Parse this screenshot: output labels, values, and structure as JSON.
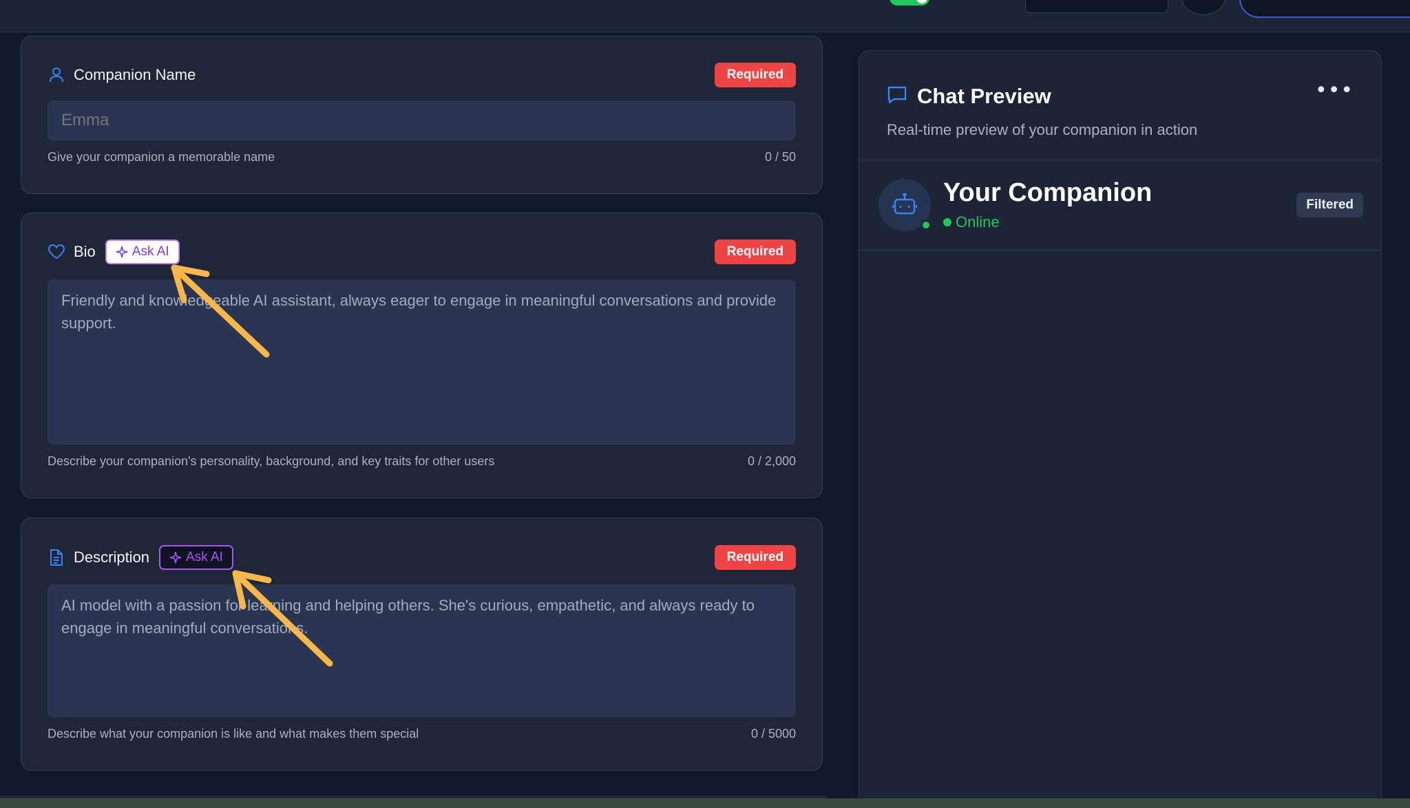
{
  "form": {
    "name": {
      "label": "Companion Name",
      "badge": "Required",
      "placeholder": "Emma",
      "hint": "Give your companion a memorable name",
      "count": "0 / 50"
    },
    "bio": {
      "label": "Bio",
      "ask_ai": "Ask AI",
      "badge": "Required",
      "placeholder": "Friendly and knowledgeable AI assistant, always eager to engage in meaningful conversations and provide support.",
      "hint": "Describe your companion's personality, background, and key traits for other users",
      "count": "0 / 2,000"
    },
    "description": {
      "label": "Description",
      "ask_ai": "Ask AI",
      "badge": "Required",
      "placeholder": "AI model with a passion for learning and helping others. She's curious, empathetic, and always ready to engage in meaningful conversations.",
      "hint": "Describe what your companion is like and what makes them special",
      "count": "0 / 5000"
    }
  },
  "preview": {
    "title": "Chat Preview",
    "subtitle": "Real-time preview of your companion in action",
    "companion_name": "Your Companion",
    "status": "Online",
    "badge": "Filtered"
  },
  "colors": {
    "accent_blue": "#3b82f6",
    "required_red": "#ef4444",
    "ask_ai_purple": "#a855f7",
    "online_green": "#22c55e",
    "annotation_arrow": "#f9b74a"
  },
  "icons": {
    "name": "user-icon",
    "bio": "heart-icon",
    "description": "document-icon",
    "ask_ai": "sparkle-icon",
    "preview": "chat-bubble-icon",
    "avatar": "robot-icon",
    "more": "more-horizontal-icon"
  }
}
